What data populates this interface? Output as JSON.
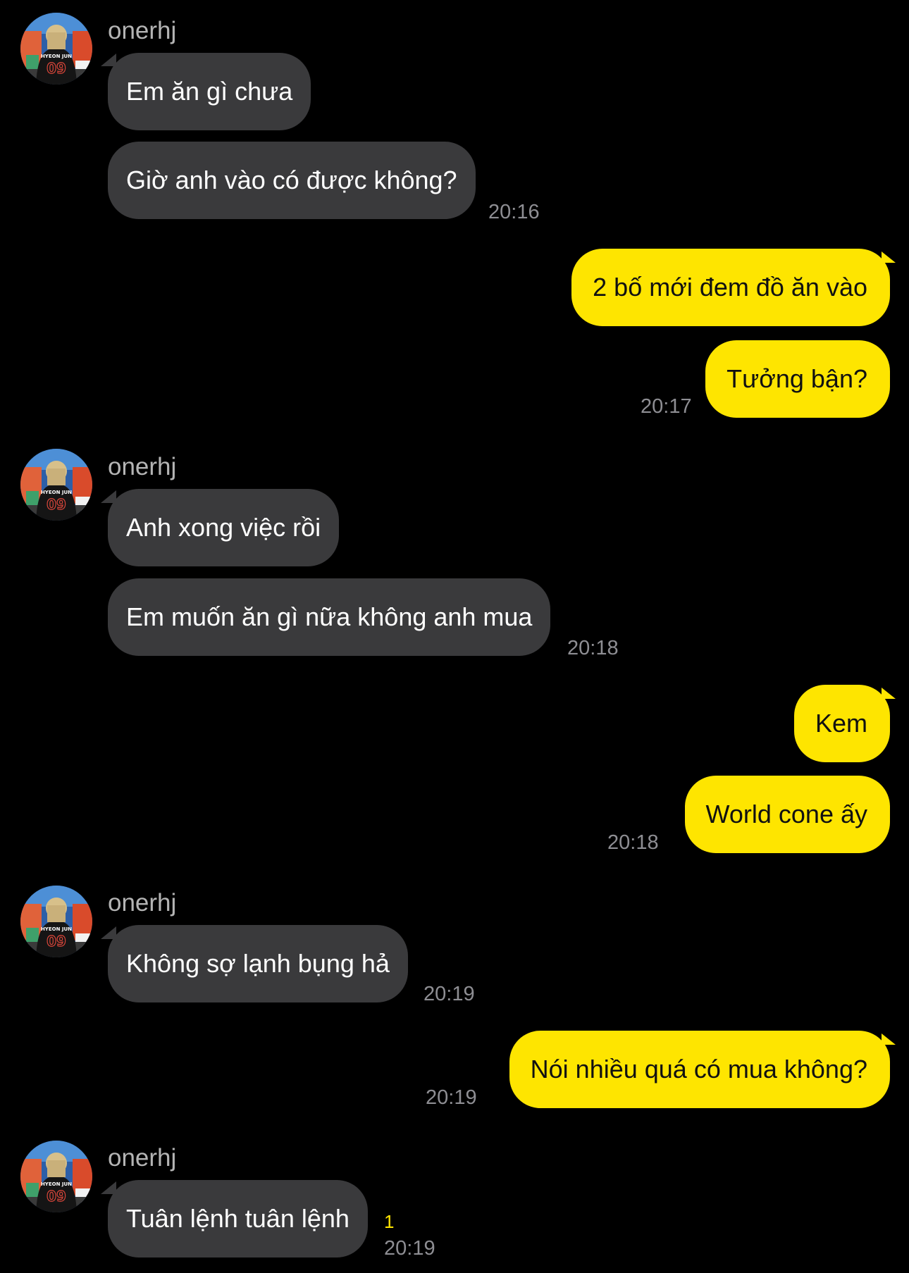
{
  "colors": {
    "background": "#000000",
    "incoming_bubble": "#3a3a3c",
    "outgoing_bubble": "#fee500",
    "timestamp": "#8e8e93",
    "sender_name": "#b4b4b4",
    "unread": "#fee500"
  },
  "icons": {
    "avatar": "avatar-icon"
  },
  "messages": {
    "g1": {
      "sender": "onerhj",
      "m1": "Em ăn gì chưa",
      "m2": "Giờ anh vào có được không?",
      "time": "20:16"
    },
    "g2": {
      "m1": "2 bố mới đem đồ ăn vào",
      "m2": "Tưởng bận?",
      "time": "20:17"
    },
    "g3": {
      "sender": "onerhj",
      "m1": "Anh xong việc rồi",
      "m2": "Em muốn ăn gì nữa không anh mua",
      "time": "20:18"
    },
    "g4": {
      "m1": "Kem",
      "m2": "World cone ấy",
      "time": "20:18"
    },
    "g5": {
      "sender": "onerhj",
      "m1": "Không sợ lạnh bụng hả",
      "time": "20:19"
    },
    "g6": {
      "m1": "Nói nhiều quá có mua không?",
      "time": "20:19"
    },
    "g7": {
      "sender": "onerhj",
      "m1": "Tuân lệnh tuân lệnh",
      "unread": "1",
      "time": "20:19"
    }
  }
}
